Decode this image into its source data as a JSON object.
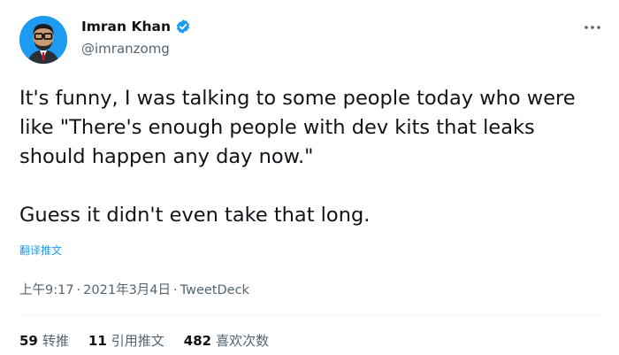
{
  "author": {
    "display_name": "Imran Khan",
    "handle": "@imranzomg",
    "verified": true
  },
  "tweet": {
    "text": "It's funny, I was talking to some people today who were\nlike \"There's enough people with dev kits that leaks\nshould happen any day now.\"\n\nGuess it didn't even take that long.",
    "translate_label": "翻译推文"
  },
  "meta": {
    "time": "上午9:17",
    "date": "2021年3月4日",
    "separator": "·",
    "source": "TweetDeck"
  },
  "stats": {
    "retweets_count": "59",
    "retweets_label": "转推",
    "quotes_count": "11",
    "quotes_label": "引用推文",
    "likes_count": "482",
    "likes_label": "喜欢次数"
  },
  "colors": {
    "accent": "#1d9bf0",
    "text": "#0f1419",
    "secondary": "#536471"
  }
}
